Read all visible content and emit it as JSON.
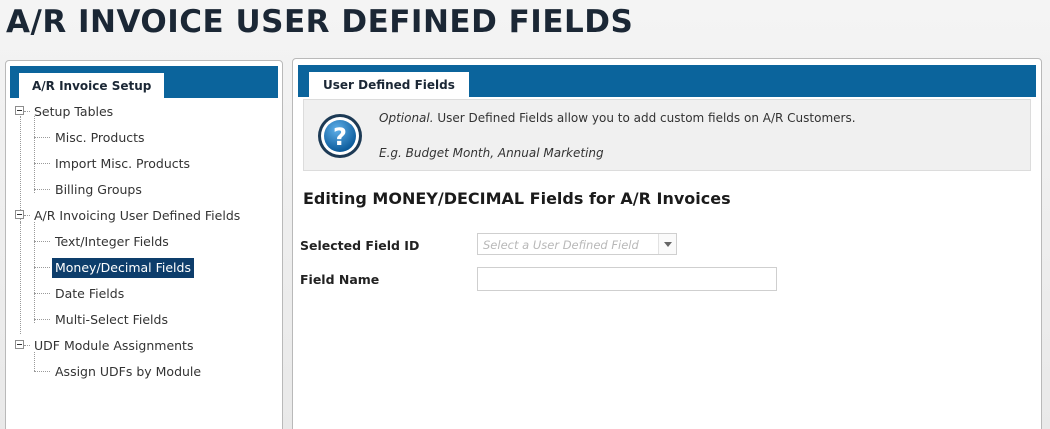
{
  "page": {
    "title": "A/R INVOICE USER DEFINED FIELDS"
  },
  "left_panel": {
    "tab_label": "A/R Invoice Setup",
    "tree": [
      {
        "label": "Setup Tables",
        "children": [
          "Misc. Products",
          "Import Misc. Products",
          "Billing Groups"
        ]
      },
      {
        "label": "A/R Invoicing User Defined Fields",
        "children": [
          "Text/Integer Fields",
          "Money/Decimal Fields",
          "Date Fields",
          "Multi-Select Fields"
        ]
      },
      {
        "label": "UDF Module Assignments",
        "children": [
          "Assign UDFs by Module"
        ]
      }
    ],
    "selected": "Money/Decimal Fields"
  },
  "right_panel": {
    "tab_label": "User Defined Fields",
    "info": {
      "icon": "help-question-icon",
      "optional_word": "Optional.",
      "line1_rest": " User Defined Fields allow you to add custom fields on A/R Customers.",
      "line2": "E.g. Budget Month, Annual Marketing"
    },
    "section_title": "Editing MONEY/DECIMAL Fields for A/R Invoices",
    "form": {
      "selected_field_label": "Selected Field ID",
      "selected_field_placeholder": "Select a User Defined Field",
      "selected_field_value": "",
      "field_name_label": "Field Name",
      "field_name_value": ""
    }
  },
  "colors": {
    "header_blue": "#0b649c",
    "selected_bg": "#0d3d6b",
    "title_color": "#1b2735"
  }
}
